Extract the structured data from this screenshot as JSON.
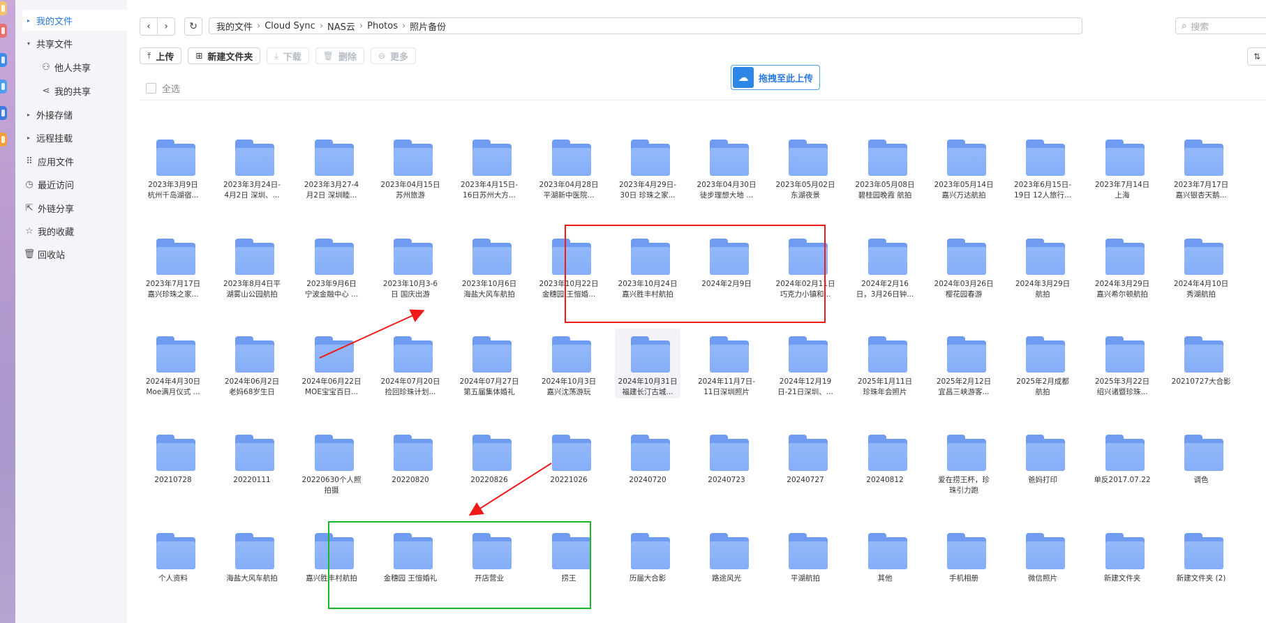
{
  "sidebar": {
    "items": [
      {
        "label": "我的文件",
        "icon": "triangle-right-icon",
        "active": true
      },
      {
        "label": "共享文件",
        "icon": "triangle-down-icon"
      },
      {
        "label": "他人共享",
        "icon": "users-icon"
      },
      {
        "label": "我的共享",
        "icon": "share-icon"
      },
      {
        "label": "外接存储",
        "icon": "triangle-right-icon"
      },
      {
        "label": "远程挂载",
        "icon": "triangle-right-icon"
      },
      {
        "label": "应用文件",
        "icon": "apps-icon"
      },
      {
        "label": "最近访问",
        "icon": "clock-icon"
      },
      {
        "label": "外链分享",
        "icon": "link-share-icon"
      },
      {
        "label": "我的收藏",
        "icon": "star-icon"
      },
      {
        "label": "回收站",
        "icon": "trash-icon"
      }
    ]
  },
  "breadcrumb": [
    "我的文件",
    "Cloud Sync",
    "NAS云",
    "Photos",
    "照片备份"
  ],
  "search": {
    "placeholder": "搜索"
  },
  "toolbar": {
    "upload": "上传",
    "new_folder": "新建文件夹",
    "download": "下载",
    "delete": "删除",
    "more": "更多"
  },
  "select_all": "全选",
  "dropzone": {
    "label": "拖拽至此上传"
  },
  "folders": [
    [
      "2023年3月9日\n杭州千岛湖宿...",
      "2023年3月24日-\n4月2日 深圳、...",
      "2023年3月27-4\n月2日 深圳睦...",
      "2023年04月15日\n苏州旅游",
      "2023年4月15日-\n16日苏州大方...",
      "2023年04月28日\n平湖新中医院...",
      "2023年4月29日-\n30日 珍珠之家...",
      "2023年04月30日\n徒步理想大地 ...",
      "2023年05月02日\n东湖夜景",
      "2023年05月08日\n碧桂园晚霞 航拍",
      "2023年05月14日\n嘉兴万达航拍",
      "2023年6月15日-\n19日 12人旅行...",
      "2023年7月14日\n上海",
      "2023年7月17日\n嘉兴银杏天鹅..."
    ],
    [
      "2023年7月17日\n嘉兴珍珠之家...",
      "2023年8月4日平\n湖雾山公园航拍",
      "2023年9月6日\n宁波金融中心 ...",
      "2023年10月3-6\n日 国庆出游",
      "2023年10月6日\n海盐大风车航拍",
      "2023年10月22日\n金穗园 王愷婚...",
      "2023年10月24日\n嘉兴胜丰村航拍",
      "2024年2月9日",
      "2024年02月11日\n巧克力小镇和...",
      "2024年2月16\n日，3月26日钟...",
      "2024年03月26日\n樱花园春游",
      "2024年3月29日\n航拍",
      "2024年3月29日\n嘉兴希尔顿航拍",
      "2024年4月10日\n秀湖航拍"
    ],
    [
      "2024年4月30日\nMoe满月仪式 ...",
      "2024年06月2日\n老妈68岁生日",
      "2024年06月22日\nMOE宝宝百日...",
      "2024年07月20日\n捡回珍珠计划...",
      "2024年07月27日\n第五届集体婚礼",
      "2024年10月3日\n嘉兴沈荡游玩",
      "2024年10月31日\n福建长汀古城...",
      "2024年11月7日-\n11日深圳照片",
      "2024年12月19\n日-21日深圳、...",
      "2025年1月11日\n珍珠年会照片",
      "2025年2月12日\n宜昌三峡游客...",
      "2025年2月成都\n航拍",
      "2025年3月22日\n绍兴诸暨珍珠...",
      "20210727大合影"
    ],
    [
      "20210728",
      "20220111",
      "20220630个人照\n拍摄",
      "20220820",
      "20220826",
      "20221026",
      "20240720",
      "20240723",
      "20240727",
      "20240812",
      "爱在捞王杯，珍\n珠引力跑",
      "爸妈打印",
      "单反2017.07.22",
      "调色"
    ],
    [
      "个人资料",
      "海盐大风车航拍",
      "嘉兴胜丰村航拍",
      "金穗园 王愷婚礼",
      "开店营业",
      "捞王",
      "历届大合影",
      "路途风光",
      "平湖航拍",
      "其他",
      "手机相册",
      "微信照片",
      "新建文件夹",
      "新建文件夹 (2)"
    ]
  ],
  "colors": {
    "accent": "#2b78e4",
    "folder": "#86aef7",
    "annotation_red": "#ef1b1b",
    "annotation_green": "#1cb82b"
  }
}
